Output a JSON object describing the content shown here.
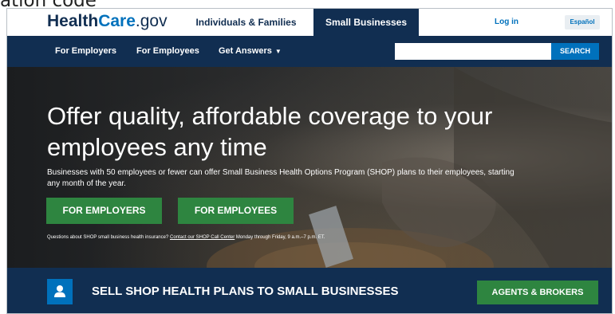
{
  "clipped_caption": "ation code",
  "header": {
    "logo": {
      "part1": "Health",
      "part2": "Care",
      "part3": ".gov"
    },
    "tabs": [
      {
        "label": "Individuals & Families"
      },
      {
        "label": "Small Businesses",
        "active": true
      }
    ],
    "login_label": "Log in",
    "language_label": "Español"
  },
  "nav": {
    "items": [
      {
        "label": "For Employers"
      },
      {
        "label": "For Employees"
      },
      {
        "label": "Get Answers"
      }
    ],
    "search": {
      "placeholder": "",
      "button_label": "SEARCH"
    }
  },
  "hero": {
    "title": "Offer quality, affordable coverage to your employees any time",
    "subtitle": "Businesses with 50 employees or fewer can offer Small Business Health Options Program (SHOP) plans to their employees, starting any month of the year.",
    "buttons": [
      {
        "label": "FOR EMPLOYERS"
      },
      {
        "label": "FOR EMPLOYEES"
      }
    ],
    "question": {
      "before": "Questions about SHOP small business health insurance? ",
      "link": "Contact our SHOP Call Center",
      "after": " Monday through Friday, 9 a.m.–7 p.m. ET."
    }
  },
  "band": {
    "icon": "person-icon",
    "title": "SELL SHOP HEALTH PLANS TO SMALL BUSINESSES",
    "button_label": "AGENTS & BROKERS"
  },
  "colors": {
    "navy": "#112e51",
    "blue": "#0071bc",
    "green": "#2e8540"
  }
}
